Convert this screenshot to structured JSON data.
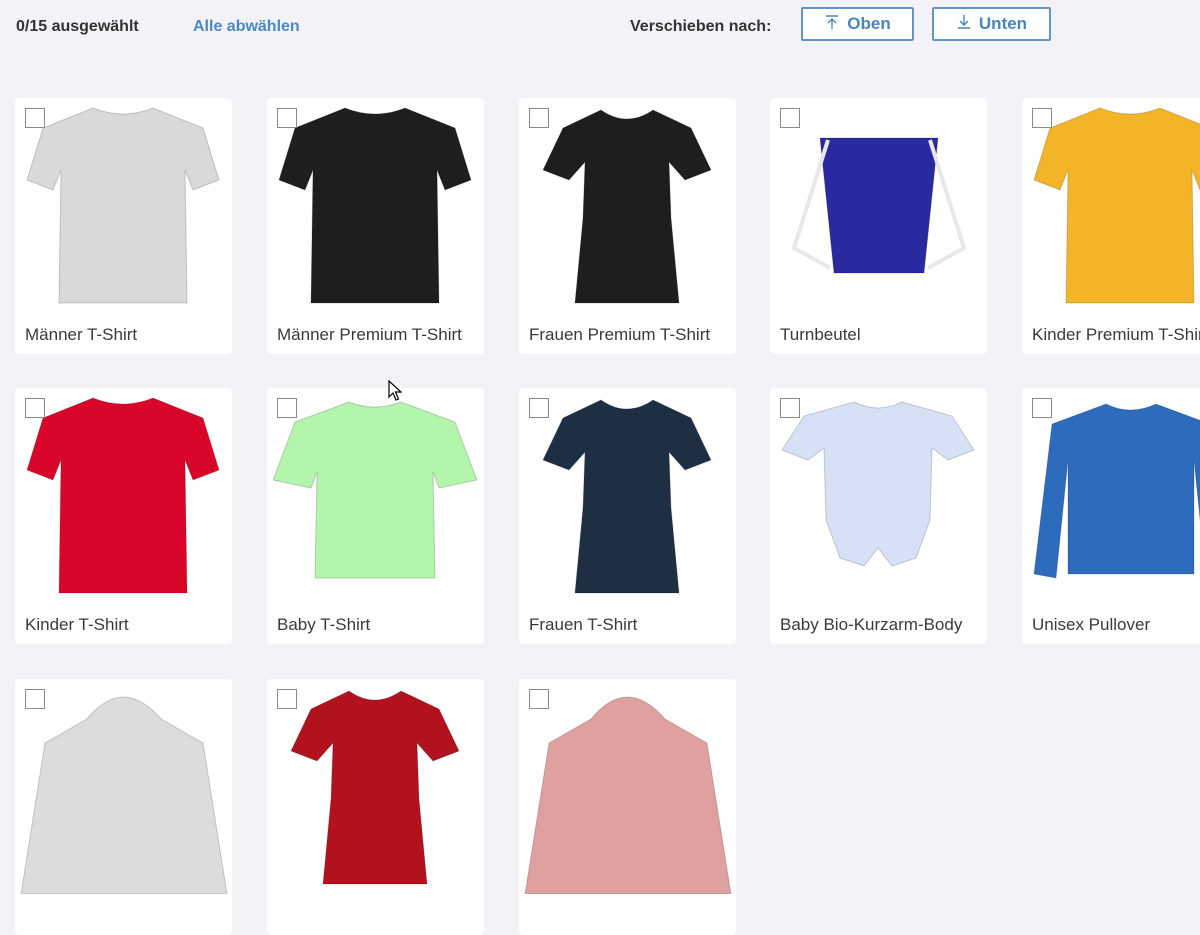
{
  "toolbar": {
    "selection_count": "0/15 ausgewählt",
    "deselect_all": "Alle abwählen",
    "move_label": "Verschieben nach:",
    "move_top": "Oben",
    "move_bottom": "Unten",
    "move_top_icon": "arrow-up-to-line-icon",
    "move_bottom_icon": "arrow-down-to-line-icon"
  },
  "products": [
    {
      "label": "Männer T-Shirt",
      "color": "#d9d9d9"
    },
    {
      "label": "Männer Premium T-Shirt",
      "color": "#1e1e1e"
    },
    {
      "label": "Frauen Premium T-Shirt",
      "color": "#1e1e1e"
    },
    {
      "label": "Turnbeutel",
      "color": "#2a2aa0"
    },
    {
      "label": "Kinder Premium T-Shirt",
      "color": "#f4b427"
    },
    {
      "label": "Kinder T-Shirt",
      "color": "#d9062a"
    },
    {
      "label": "Baby T-Shirt",
      "color": "#b2f5ab"
    },
    {
      "label": "Frauen T-Shirt",
      "color": "#1e2f44"
    },
    {
      "label": "Baby Bio-Kurzarm-Body",
      "color": "#d6e1f5"
    },
    {
      "label": "Unisex Pullover",
      "color": "#2d6bbd"
    },
    {
      "label": "",
      "color": "#dcdcdc"
    },
    {
      "label": "",
      "color": "#b2121e"
    },
    {
      "label": "",
      "color": "#dfa0a0"
    }
  ],
  "colors": {
    "accent": "#4a8ac4",
    "background": "#f3f2f6"
  }
}
